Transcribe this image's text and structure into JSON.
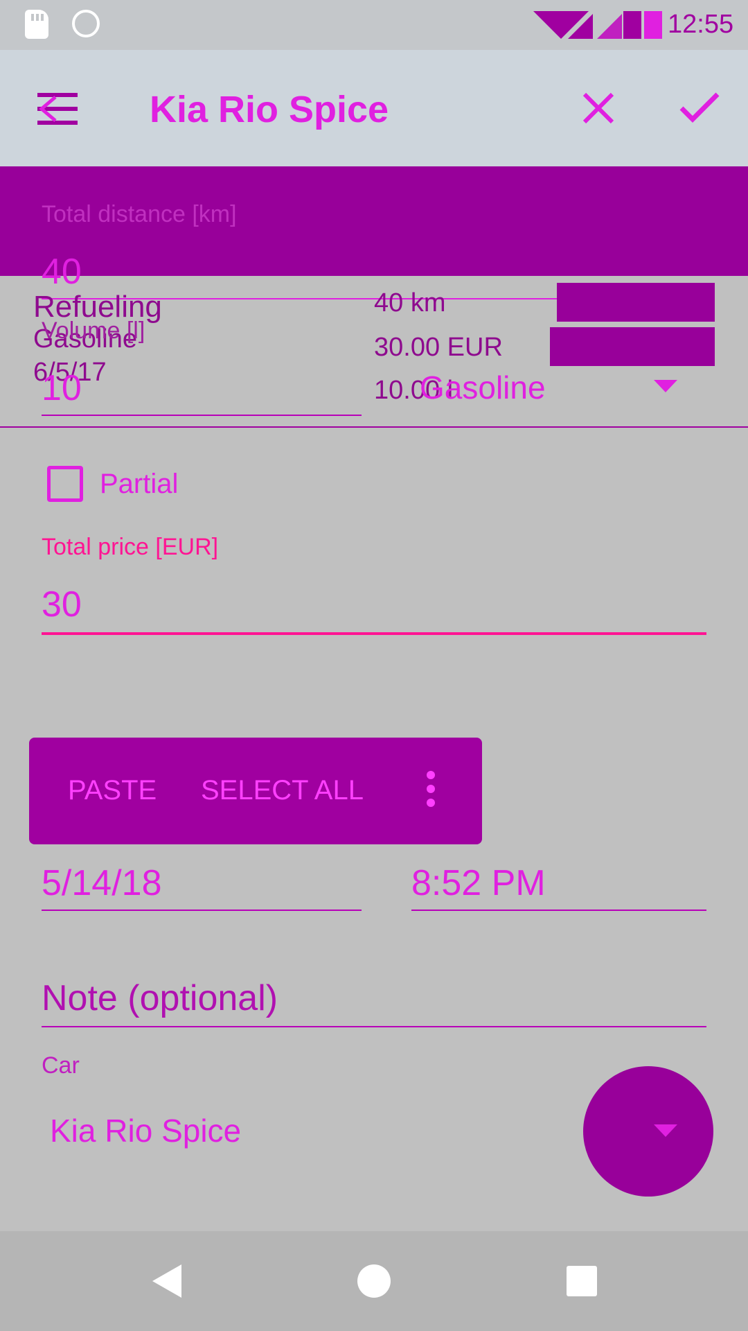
{
  "status_bar": {
    "time": "12:55"
  },
  "toolbar": {
    "title": "Kia Rio Spice",
    "menu_icon": "menu-icon",
    "close_icon": "close-icon",
    "confirm_icon": "check-icon"
  },
  "form": {
    "distance_label": "Total distance [km]",
    "distance_value": "40",
    "volume_label": "Volume [l]",
    "volume_value": "10",
    "fuel_type_value": "Gasoline",
    "partial_label": "Partial",
    "price_label": "Total price [EUR]",
    "price_value": "30",
    "date_value": "5/14/18",
    "time_value": "8:52 PM",
    "note_placeholder": "Note (optional)",
    "car_label": "Car",
    "car_value": "Kia Rio Spice"
  },
  "previous_entry": {
    "type": "Refueling",
    "fuel": "Gasoline",
    "date": "6/5/17",
    "distance": "40 km",
    "price": "30.00 EUR",
    "volume": "10.00 l"
  },
  "context_menu": {
    "paste": "PASTE",
    "select_all": "SELECT ALL"
  },
  "colors": {
    "accent": "#e020e0",
    "primary": "#98009a",
    "price_accent": "#ff1493"
  }
}
